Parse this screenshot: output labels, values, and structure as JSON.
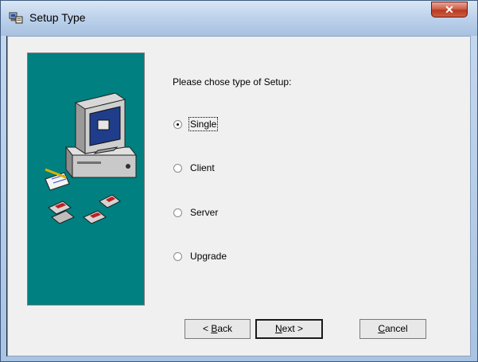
{
  "window": {
    "title": "Setup Type"
  },
  "prompt": "Please chose type of Setup:",
  "options": [
    {
      "label": "Single",
      "checked": true
    },
    {
      "label": "Client",
      "checked": false
    },
    {
      "label": "Server",
      "checked": false
    },
    {
      "label": "Upgrade",
      "checked": false
    }
  ],
  "buttons": {
    "back": {
      "prefix": "< ",
      "mnemonic": "B",
      "rest": "ack"
    },
    "next": {
      "mnemonic": "N",
      "rest": "ext >"
    },
    "cancel": {
      "mnemonic": "C",
      "rest": "ancel"
    }
  },
  "colors": {
    "side_panel": "#008080",
    "close_button": "#c94a33"
  },
  "icons": [
    "setup-app-icon",
    "close-icon",
    "computer-illustration"
  ]
}
